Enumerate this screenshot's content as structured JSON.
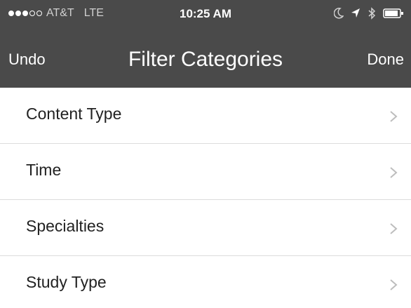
{
  "status_bar": {
    "signal_filled": 3,
    "signal_total": 5,
    "carrier": "AT&T",
    "network": "LTE",
    "time": "10:25 AM",
    "icons": [
      "moon-icon",
      "location-arrow-icon",
      "bluetooth-icon",
      "battery-icon"
    ]
  },
  "nav": {
    "left_label": "Undo",
    "title": "Filter Categories",
    "right_label": "Done"
  },
  "categories": [
    {
      "label": "Content Type",
      "icon": "chevron-right-icon"
    },
    {
      "label": "Time",
      "icon": "chevron-right-icon"
    },
    {
      "label": "Specialties",
      "icon": "chevron-right-icon"
    },
    {
      "label": "Study Type",
      "icon": "chevron-right-icon"
    }
  ],
  "colors": {
    "header_bg": "#4a4a4a",
    "text_primary": "#222222",
    "chevron": "#bdbdbd",
    "divider": "#dcdcdc"
  }
}
